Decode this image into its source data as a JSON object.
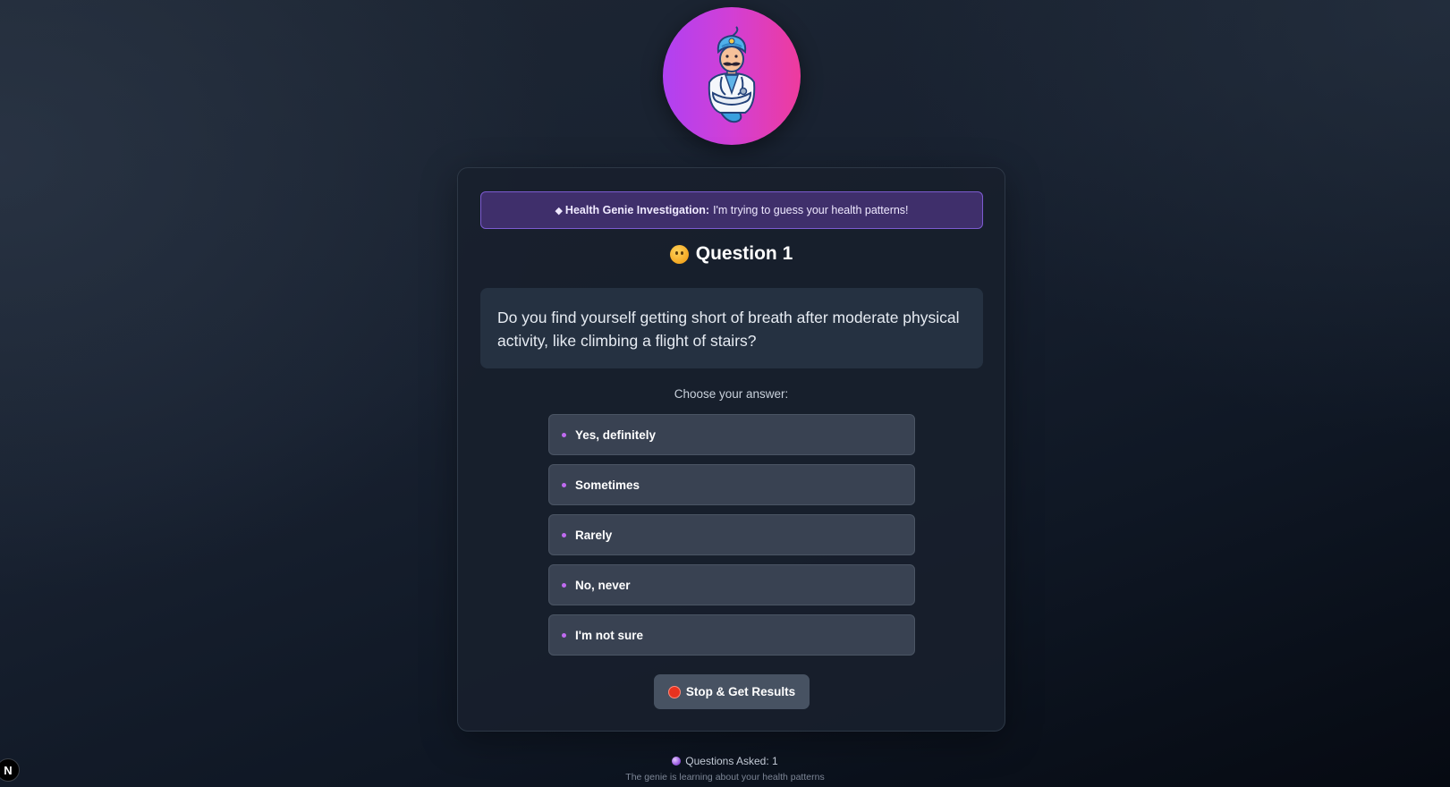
{
  "banner": {
    "icon": "diamond-icon",
    "bold": "Health Genie Investigation:",
    "text": "I'm trying to guess your health patterns!"
  },
  "question": {
    "emoji": "thinking-face-icon",
    "title": "Question 1",
    "text": "Do you find yourself getting short of breath after moderate physical activity, like climbing a flight of stairs?"
  },
  "answers": {
    "label": "Choose your answer:",
    "options": [
      "Yes, definitely",
      "Sometimes",
      "Rarely",
      "No, never",
      "I'm not sure"
    ]
  },
  "stop": {
    "icon": "red-circle-icon",
    "label": "Stop & Get Results"
  },
  "footer": {
    "icon": "crystal-ball-icon",
    "count_text": "Questions Asked: 1",
    "subtitle": "The genie is learning about your health patterns"
  },
  "badge": {
    "label": "N"
  },
  "colors": {
    "avatar_gradient_start": "#b041f2",
    "avatar_gradient_end": "#ee3b9d",
    "banner_bg": "#3f2f6b",
    "option_bg": "#394252",
    "bullet": "#c06bf0",
    "stop_dot": "#e8321f"
  }
}
